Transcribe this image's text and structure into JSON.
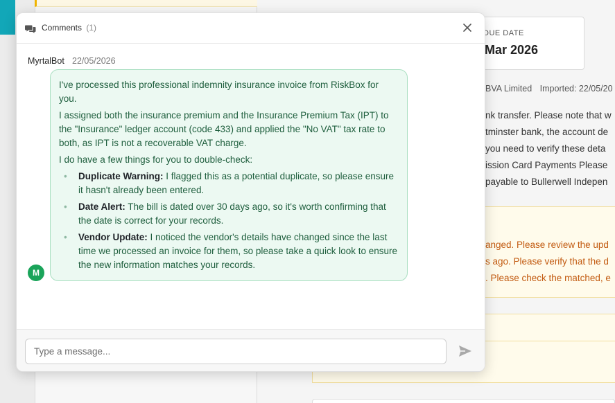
{
  "background": {
    "due_date_label": "DUE DATE",
    "due_date_value": "Mar 2026",
    "supplier_fragment": "BVA Limited",
    "imported_fragment": "Imported: 22/05/20",
    "notes_lines": [
      "nk transfer. Please note that w",
      "tminster bank, the account de",
      " you need to verify these deta",
      "ission Card Payments Please",
      "payable to Bullerwell Indepen"
    ],
    "warning_lines": [
      "anged. Please review the upd",
      "s ago. Please verify that the d",
      ". Please check the matched, e"
    ]
  },
  "comments": {
    "title": "Comments",
    "count": "(1)",
    "message": {
      "author": "MyrtalBot",
      "date": "22/05/2026",
      "avatar_initial": "M",
      "paragraphs": [
        "I've processed this professional indemnity insurance invoice from RiskBox for you.",
        "I assigned both the insurance premium and the Insurance Premium Tax (IPT) to the \"Insurance\" ledger account (code 433) and applied the \"No VAT\" tax rate to both, as IPT is not a recoverable VAT charge.",
        "I do have a few things for you to double-check:"
      ],
      "bullets": [
        {
          "title": "Duplicate Warning:",
          "text": " I flagged this as a potential duplicate, so please ensure it hasn't already been entered."
        },
        {
          "title": "Date Alert:",
          "text": " The bill is dated over 30 days ago, so it's worth confirming that the date is correct for your records."
        },
        {
          "title": "Vendor Update:",
          "text": " I noticed the vendor's details have changed since the last time we processed an invoice for them, so please take a quick look to ensure the new information matches your records."
        }
      ]
    },
    "input_placeholder": "Type a message...",
    "input_value": ""
  },
  "icons": {
    "header": "comments-icon",
    "close": "close-icon",
    "send": "send-icon"
  },
  "colors": {
    "accent_green": "#1aa45a",
    "bubble_bg": "#ecf9f2",
    "warning_text": "#c25a10",
    "teal": "#12a7b8"
  }
}
